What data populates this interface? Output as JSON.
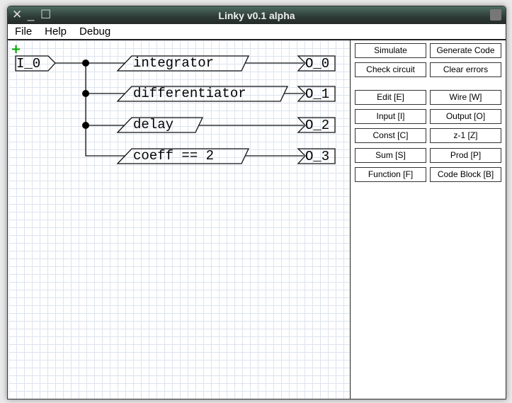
{
  "window": {
    "title": "Linky v0.1 alpha"
  },
  "menu": [
    "File",
    "Help",
    "Debug"
  ],
  "diagram": {
    "input": "I_0",
    "blocks": [
      "integrator",
      "differentiator",
      "delay",
      "coeff == 2"
    ],
    "outputs": [
      "O_0",
      "O_1",
      "O_2",
      "O_3"
    ]
  },
  "buttons": [
    "Simulate",
    "Generate Code",
    "Check circuit",
    "Clear errors",
    "Edit [E]",
    "Wire [W]",
    "Input [I]",
    "Output [O]",
    "Const [C]",
    "z-1 [Z]",
    "Sum [S]",
    "Prod [P]",
    "Function [F]",
    "Code Block [B]"
  ]
}
